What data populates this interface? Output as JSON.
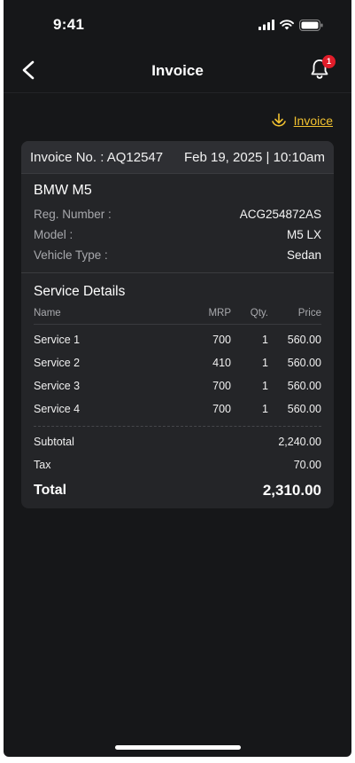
{
  "status_bar": {
    "time": "9:41"
  },
  "header": {
    "title": "Invoice",
    "notification_count": "1"
  },
  "download": {
    "label": "Invoice"
  },
  "invoice": {
    "number_label": "Invoice No. : AQ12547",
    "datetime": "Feb 19, 2025 | 10:10am",
    "vehicle": {
      "name": "BMW M5",
      "fields": [
        {
          "label": "Reg. Number :",
          "value": "ACG254872AS"
        },
        {
          "label": "Model :",
          "value": "M5 LX"
        },
        {
          "label": "Vehicle Type :",
          "value": "Sedan"
        }
      ]
    },
    "services": {
      "title": "Service Details",
      "columns": {
        "name": "Name",
        "mrp": "MRP",
        "qty": "Qty.",
        "price": "Price"
      },
      "rows": [
        {
          "name": "Service 1",
          "mrp": "700",
          "qty": "1",
          "price": "560.00"
        },
        {
          "name": "Service 2",
          "mrp": "410",
          "qty": "1",
          "price": "560.00"
        },
        {
          "name": "Service 3",
          "mrp": "700",
          "qty": "1",
          "price": "560.00"
        },
        {
          "name": "Service 4",
          "mrp": "700",
          "qty": "1",
          "price": "560.00"
        }
      ]
    },
    "summary": {
      "subtotal_label": "Subtotal",
      "subtotal": "2,240.00",
      "tax_label": "Tax",
      "tax": "70.00",
      "total_label": "Total",
      "total": "2,310.00"
    }
  },
  "colors": {
    "background": "#161719",
    "card": "#242528",
    "accent": "#f2c230",
    "badge": "#e11d2a"
  }
}
